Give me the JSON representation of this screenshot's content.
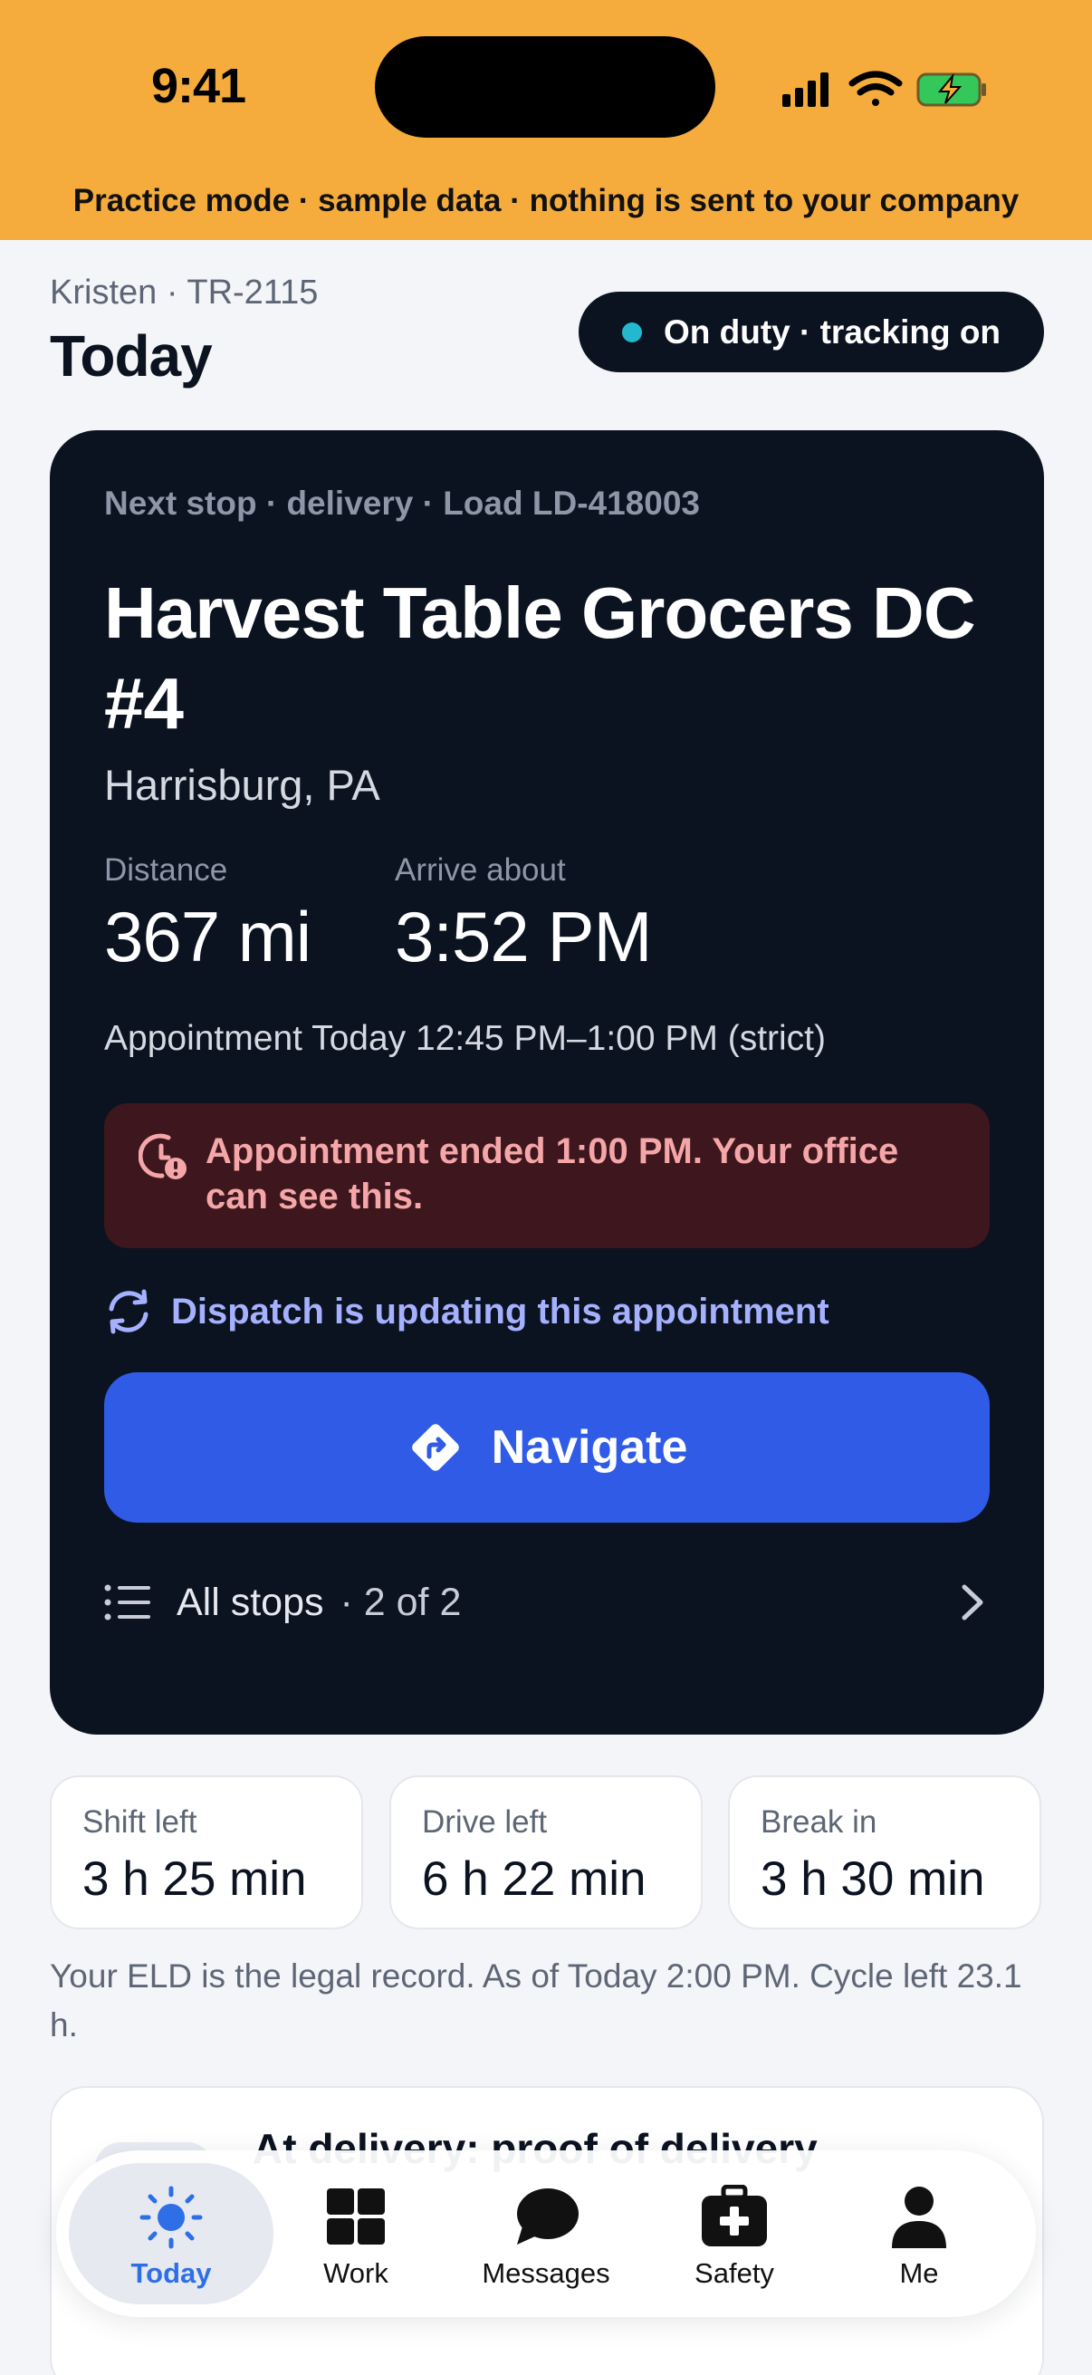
{
  "status_bar": {
    "time": "9:41"
  },
  "banner": {
    "practice_text": "Practice mode · sample data · nothing is sent to your company"
  },
  "header": {
    "driver_line": "Kristen · TR-2115",
    "title": "Today",
    "duty_status": "On duty · tracking on"
  },
  "next_stop": {
    "eyebrow": "Next stop · delivery · Load LD-418003",
    "name": "Harvest Table Grocers DC #4",
    "city": "Harrisburg, PA",
    "distance_label": "Distance",
    "distance_value": "367 mi",
    "arrive_label": "Arrive about",
    "arrive_value": "3:52 PM",
    "appointment": "Appointment Today 12:45 PM–1:00 PM (strict)",
    "alert": "Appointment ended 1:00 PM. Your office can see this.",
    "dispatch_note": "Dispatch is updating this appointment",
    "navigate_label": "Navigate",
    "all_stops_label": "All stops",
    "all_stops_count": "· 2 of 2"
  },
  "hours": [
    {
      "label": "Shift left",
      "value": "3 h 25 min"
    },
    {
      "label": "Drive left",
      "value": "6 h 22 min"
    },
    {
      "label": "Break in",
      "value": "3 h 30 min"
    }
  ],
  "eld_note": "Your ELD is the legal record. As of Today 2:00 PM. Cycle left 23.1 h.",
  "pod_card": {
    "title": "At delivery: proof of delivery"
  },
  "tabs": [
    {
      "label": "Today",
      "icon": "sun-icon",
      "active": true
    },
    {
      "label": "Work",
      "icon": "grid-icon",
      "active": false
    },
    {
      "label": "Messages",
      "icon": "chat-bubble-icon",
      "active": false
    },
    {
      "label": "Safety",
      "icon": "first-aid-kit-icon",
      "active": false
    },
    {
      "label": "Me",
      "icon": "person-icon",
      "active": false
    }
  ],
  "colors": {
    "banner": "#f5ac3c",
    "card": "#0b1220",
    "accent_blue": "#2f5be6",
    "alert_bg": "#3d171d",
    "alert_text": "#f5a6a8",
    "tracking_dot": "#22b8cf",
    "active_tab": "#2e6fe8"
  }
}
